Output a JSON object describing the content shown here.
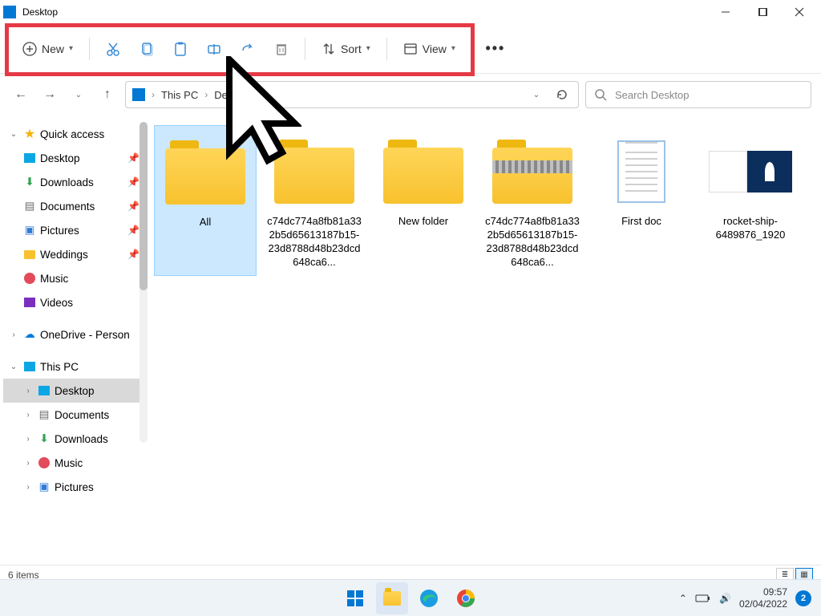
{
  "window": {
    "title": "Desktop"
  },
  "toolbar": {
    "new_label": "New",
    "sort_label": "Sort",
    "view_label": "View"
  },
  "breadcrumb": {
    "seg1": "This PC",
    "seg2": "Desktop"
  },
  "search": {
    "placeholder": "Search Desktop"
  },
  "sidebar": {
    "quick_access": "Quick access",
    "desktop": "Desktop",
    "downloads": "Downloads",
    "documents": "Documents",
    "pictures": "Pictures",
    "weddings": "Weddings",
    "music": "Music",
    "videos": "Videos",
    "onedrive": "OneDrive - Person",
    "this_pc": "This PC",
    "tp_desktop": "Desktop",
    "tp_documents": "Documents",
    "tp_downloads": "Downloads",
    "tp_music": "Music",
    "tp_pictures": "Pictures"
  },
  "files": {
    "f1": "All",
    "f2": "c74dc774a8fb81a332b5d65613187b15-23d8788d48b23dcd648ca6...",
    "f3": "New folder",
    "f4": "c74dc774a8fb81a332b5d65613187b15-23d8788d48b23dcd648ca6...",
    "f5": "First doc",
    "f6": "rocket-ship-6489876_1920"
  },
  "status": {
    "item_count": "6 items"
  },
  "tray": {
    "time": "09:57",
    "date": "02/04/2022",
    "notif_count": "2"
  }
}
